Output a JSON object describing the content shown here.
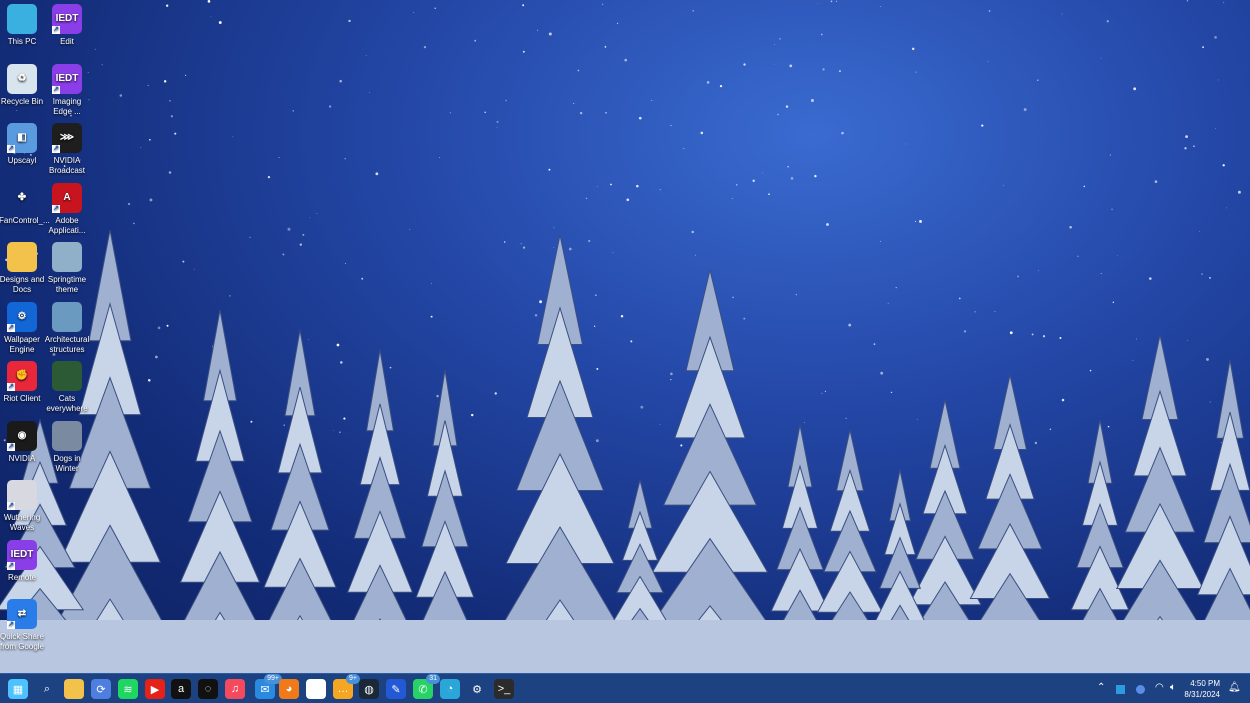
{
  "desktop_icons": [
    {
      "label": "This PC",
      "icon": "monitor-icon",
      "color": "#3ab0e0",
      "text": ""
    },
    {
      "label": "Edit",
      "icon": "iedt-icon",
      "color": "#8a3ee8",
      "text": "IEDT",
      "shortcut": true
    },
    {
      "label": "Recycle Bin",
      "icon": "recycle-bin-icon",
      "color": "#d8e4ee",
      "text": "♻"
    },
    {
      "label": "Imaging Edge ...",
      "icon": "iedt-icon",
      "color": "#8a3ee8",
      "text": "IEDT",
      "shortcut": true
    },
    {
      "label": "Upscayl",
      "icon": "upscayl-icon",
      "color": "#5a9be0",
      "text": "◧",
      "shortcut": true
    },
    {
      "label": "NVIDIA Broadcast",
      "icon": "nvidia-broadcast-icon",
      "color": "#1e1e1e",
      "text": "⋙",
      "shortcut": true
    },
    {
      "label": "FanControl_...",
      "icon": "fan-icon",
      "color": "transparent",
      "text": "✤"
    },
    {
      "label": "Adobe Applicati...",
      "icon": "adobe-icon",
      "color": "#c8141e",
      "text": "A",
      "shortcut": true
    },
    {
      "label": "Designs and Docs",
      "icon": "folder-icon",
      "color": "#f3c24a",
      "text": ""
    },
    {
      "label": "Springtime theme",
      "icon": "theme-image-icon",
      "color": "#8fb0c8",
      "text": ""
    },
    {
      "label": "Wallpaper Engine",
      "icon": "wallpaper-engine-icon",
      "color": "#1366d6",
      "text": "⚙",
      "shortcut": true
    },
    {
      "label": "Architectural structures",
      "icon": "theme-image-icon",
      "color": "#6a9ac0",
      "text": ""
    },
    {
      "label": "Riot Client",
      "icon": "riot-icon",
      "color": "#e8283a",
      "text": "✊",
      "shortcut": true
    },
    {
      "label": "Cats everywhere",
      "icon": "theme-image-icon",
      "color": "#2c5a34",
      "text": ""
    },
    {
      "label": "NVIDIA",
      "icon": "nvidia-icon",
      "color": "#1a1a1a",
      "text": "◉",
      "shortcut": true
    },
    {
      "label": "Dogs in Winter",
      "icon": "theme-image-icon",
      "color": "#7a8aa0",
      "text": ""
    },
    {
      "label": "Wuthering Waves",
      "icon": "game-icon",
      "color": "#d8d8e0",
      "text": "",
      "shortcut": true
    },
    null,
    {
      "label": "Remote",
      "icon": "iedt-icon",
      "color": "#8a3ee8",
      "text": "IEDT",
      "shortcut": true
    },
    null,
    {
      "label": "Quick Share from Google",
      "icon": "quick-share-icon",
      "color": "#2a7de8",
      "text": "⇄",
      "shortcut": true
    }
  ],
  "taskbar": {
    "apps": [
      {
        "name": "start",
        "icon": "windows-icon",
        "color": "#4cc2ff",
        "text": "▦"
      },
      {
        "name": "search",
        "icon": "search-icon",
        "color": "transparent",
        "text": "⌕"
      },
      {
        "name": "file-explorer",
        "icon": "folder-icon",
        "color": "#f3c24a",
        "text": ""
      },
      {
        "name": "app-sync",
        "icon": "sync-icon",
        "color": "#4d7ee0",
        "text": "⟳"
      },
      {
        "name": "spotify",
        "icon": "spotify-icon",
        "color": "#1ed760",
        "text": "≋"
      },
      {
        "name": "youtube-music",
        "icon": "youtube-music-icon",
        "color": "#e62117",
        "text": "▶"
      },
      {
        "name": "app-dark",
        "icon": "app-icon",
        "color": "#111",
        "text": "a"
      },
      {
        "name": "app-yellow",
        "icon": "circle-app-icon",
        "color": "#111",
        "text": "◌"
      },
      {
        "name": "apple-music",
        "icon": "music-icon",
        "color": "#f54a5e",
        "text": "♫"
      },
      {
        "name": "mail",
        "icon": "mail-icon",
        "color": "#2a8ae0",
        "text": "✉",
        "badge": "99+"
      },
      {
        "name": "firefox",
        "icon": "firefox-icon",
        "color": "#f07a1a",
        "text": "◕"
      },
      {
        "name": "slack",
        "icon": "slack-icon",
        "color": "#fff",
        "text": "✱"
      },
      {
        "name": "chat",
        "icon": "chat-icon",
        "color": "#f5a623",
        "text": "…",
        "badge": "9+"
      },
      {
        "name": "steam",
        "icon": "steam-icon",
        "color": "#1b2838",
        "text": "◍"
      },
      {
        "name": "app-blue",
        "icon": "app-icon",
        "color": "#2358d6",
        "text": "✎"
      },
      {
        "name": "whatsapp",
        "icon": "whatsapp-icon",
        "color": "#25d366",
        "text": "✆",
        "badge": "31"
      },
      {
        "name": "edge",
        "icon": "edge-icon",
        "color": "#2aa6d8",
        "text": "◔"
      },
      {
        "name": "settings",
        "icon": "gear-icon",
        "color": "transparent",
        "text": "⚙"
      },
      {
        "name": "terminal",
        "icon": "terminal-icon",
        "color": "#2b2b2b",
        "text": ">_"
      }
    ],
    "time": "4:50 PM",
    "date": "8/31/2024"
  }
}
